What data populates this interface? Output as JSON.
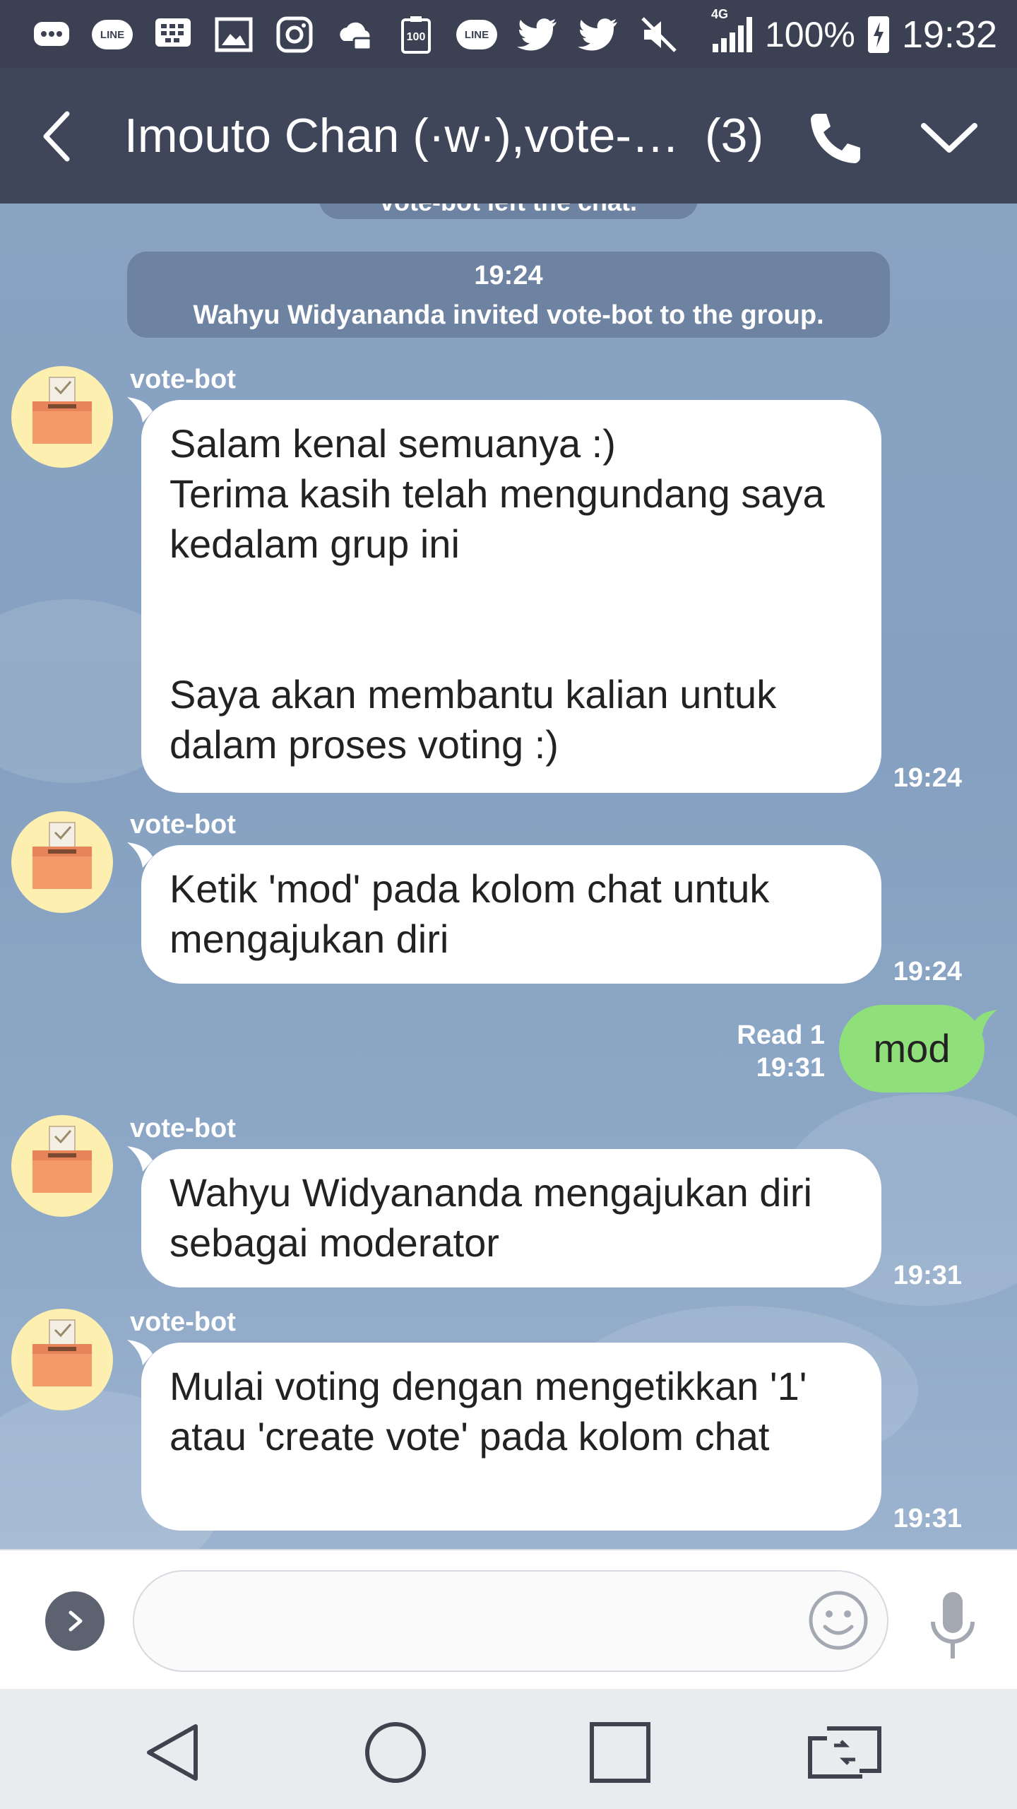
{
  "status_bar": {
    "battery_percent": "100%",
    "time": "19:32",
    "network": "4G",
    "notification_icons": [
      "bbm-icon",
      "line-icon",
      "blackberry-icon",
      "gallery-icon",
      "instagram-icon",
      "cloud-icon",
      "app-100-icon",
      "line-icon",
      "twitter-icon",
      "twitter-icon",
      "mute-icon"
    ],
    "line_label": "LINE",
    "app_100_label": "100"
  },
  "header": {
    "title": "Imouto Chan (·w·),vote-…",
    "member_count": "(3)"
  },
  "chat": {
    "system_top": "vote-bot left the chat.",
    "system_main_time": "19:24",
    "system_main_text": "Wahyu Widyananda invited vote-bot to the group.",
    "messages": [
      {
        "sender": "vote-bot",
        "text": "Salam kenal semuanya :)\nTerima kasih telah mengundang saya kedalam grup ini\n\n\nSaya akan membantu kalian untuk dalam proses voting :)",
        "time": "19:24"
      },
      {
        "sender": "vote-bot",
        "text": "Ketik 'mod' pada kolom chat untuk mengajukan diri",
        "time": "19:24"
      },
      {
        "text": "mod",
        "read": "Read 1",
        "time": "19:31"
      },
      {
        "sender": "vote-bot",
        "text": "Wahyu Widyananda mengajukan diri sebagai moderator",
        "time": "19:31"
      },
      {
        "sender": "vote-bot",
        "text": "Mulai voting dengan mengetikkan '1' atau 'create vote' pada kolom chat",
        "time": "19:31"
      }
    ]
  },
  "input": {
    "value": "",
    "placeholder": ""
  },
  "colors": {
    "header_bg": "#3f4659",
    "chat_bg": "#8aa3c3",
    "my_bubble": "#8fe07a",
    "their_bubble": "#ffffff"
  }
}
